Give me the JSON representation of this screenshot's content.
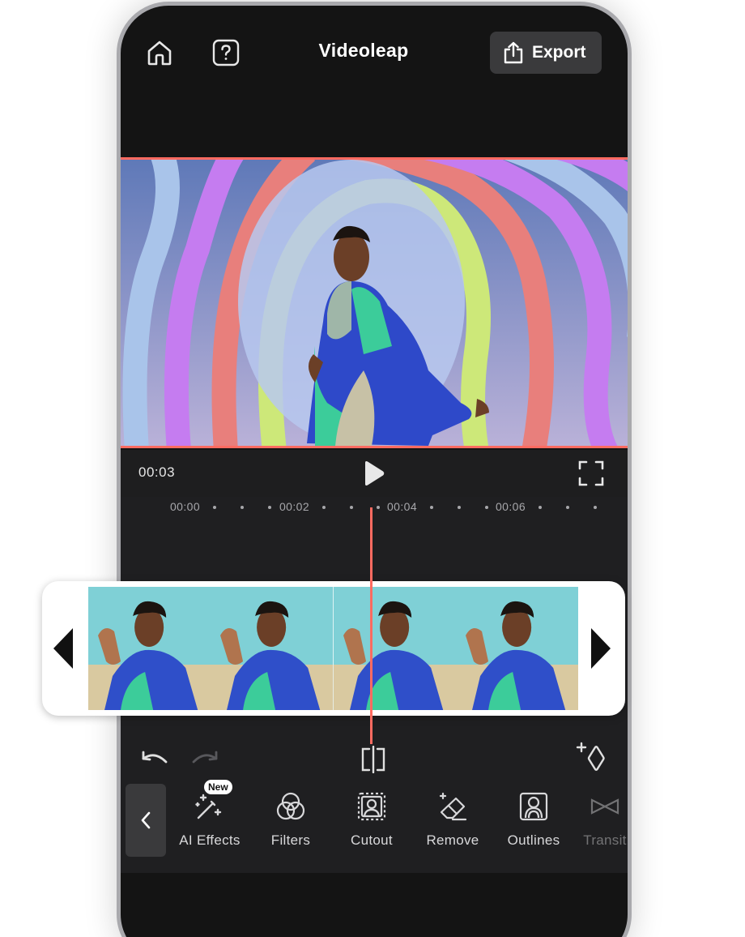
{
  "header": {
    "title": "Videoleap",
    "export_label": "Export",
    "icons": [
      "home-icon",
      "help-icon",
      "share-icon"
    ]
  },
  "playback": {
    "current_time": "00:03",
    "icons": [
      "play-icon",
      "fullscreen-icon"
    ]
  },
  "ruler": {
    "labels": [
      "00:00",
      "00:02",
      "00:04",
      "00:06"
    ]
  },
  "edit_actions": {
    "icons": [
      "undo-icon",
      "redo-icon",
      "split-icon",
      "add-keyframe-icon"
    ]
  },
  "tools": {
    "items": [
      {
        "label": "AI Effects",
        "icon": "magic-wand-icon",
        "badge": "New"
      },
      {
        "label": "Filters",
        "icon": "filters-icon"
      },
      {
        "label": "Cutout",
        "icon": "cutout-icon"
      },
      {
        "label": "Remove",
        "icon": "eraser-icon"
      },
      {
        "label": "Outlines",
        "icon": "outlines-icon"
      },
      {
        "label": "Transit",
        "icon": "transition-icon"
      }
    ]
  },
  "colors": {
    "accent": "#ff6b61",
    "background": "#141414",
    "panel": "#1f1f21",
    "button": "#3a3a3c"
  }
}
